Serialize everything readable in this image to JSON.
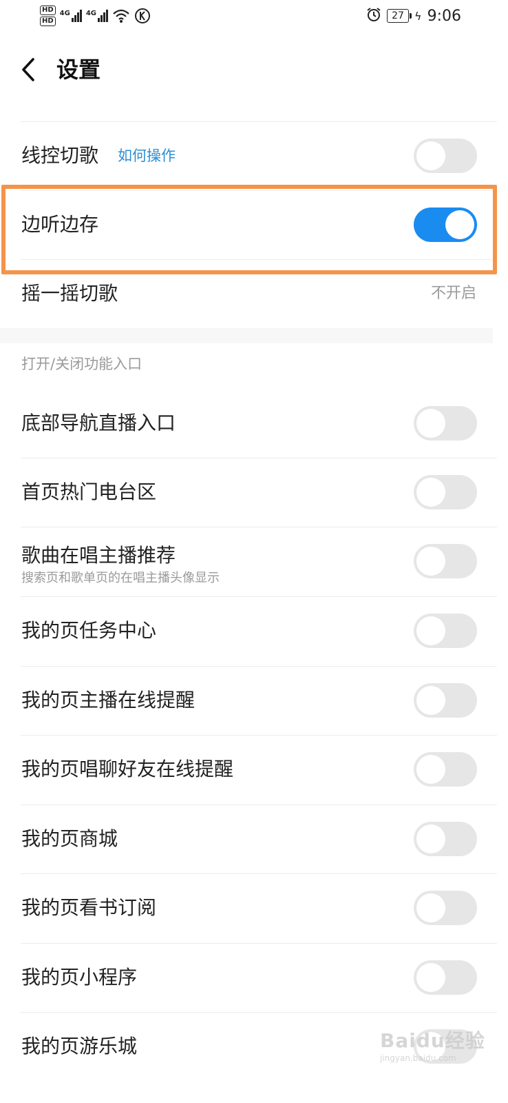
{
  "status_bar": {
    "hd1": "HD",
    "hd2": "HD",
    "sig1_label": "4G",
    "sig2_label": "4G",
    "battery": "27",
    "time": "9:06",
    "icons": [
      "hd-icon",
      "signal-icon",
      "wifi-icon",
      "k-icon",
      "alarm-icon",
      "battery-icon",
      "charging-icon"
    ]
  },
  "header": {
    "title": "设置",
    "back_icon": "chevron-left-icon"
  },
  "rows_top": [
    {
      "label": "线控切歌",
      "link": "如何操作",
      "toggle": false
    },
    {
      "label": "边听边存",
      "toggle": true
    },
    {
      "label": "摇一摇切歌",
      "value": "不开启"
    }
  ],
  "section": {
    "header": "打开/关闭功能入口",
    "rows": [
      {
        "label": "底部导航直播入口",
        "toggle": false
      },
      {
        "label": "首页热门电台区",
        "toggle": false
      },
      {
        "label": "歌曲在唱主播推荐",
        "sub": "搜索页和歌单页的在唱主播头像显示",
        "toggle": false
      },
      {
        "label": "我的页任务中心",
        "toggle": false
      },
      {
        "label": "我的页主播在线提醒",
        "toggle": false
      },
      {
        "label": "我的页唱聊好友在线提醒",
        "toggle": false
      },
      {
        "label": "我的页商城",
        "toggle": false
      },
      {
        "label": "我的页看书订阅",
        "toggle": false
      },
      {
        "label": "我的页小程序",
        "toggle": false
      },
      {
        "label": "我的页游乐城",
        "toggle": false
      }
    ]
  },
  "colors": {
    "toggle_on": "#1a8cf0",
    "toggle_off": "#e6e6e6",
    "link": "#2a8fd6",
    "highlight": "#f4944a"
  },
  "watermark": {
    "brand": "Baidu经验",
    "url": "jingyan.baidu.com"
  }
}
